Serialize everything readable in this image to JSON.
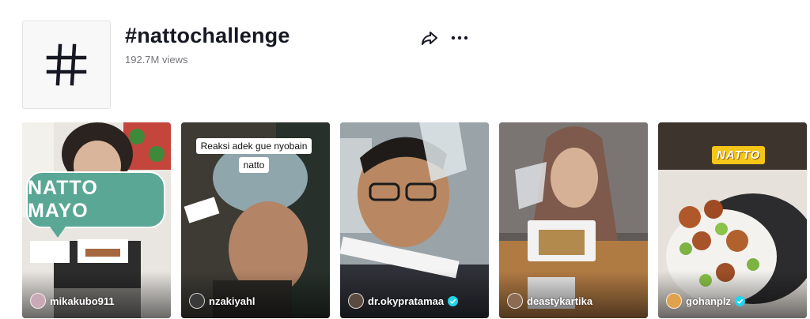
{
  "hashtag": {
    "title": "#nattochallenge",
    "views": "192.7M views",
    "icon": "hashtag-icon"
  },
  "actions": {
    "share_icon": "share-icon",
    "more_icon": "more-options-icon"
  },
  "videos": [
    {
      "username": "mikakubo911",
      "verified": false,
      "sticker": "NATTO MAYO"
    },
    {
      "username": "nzakiyahl",
      "verified": false,
      "caption": "Reaksi adek gue nyobain natto"
    },
    {
      "username": "dr.okypratamaa",
      "verified": true
    },
    {
      "username": "deastykartika",
      "verified": false
    },
    {
      "username": "gohanplz",
      "verified": true,
      "sticker": "NATTO"
    }
  ],
  "colors": {
    "verified_badge": "#20d5ec",
    "sticker_green": "#5aa796",
    "sticker_yellow": "#f5c518"
  }
}
